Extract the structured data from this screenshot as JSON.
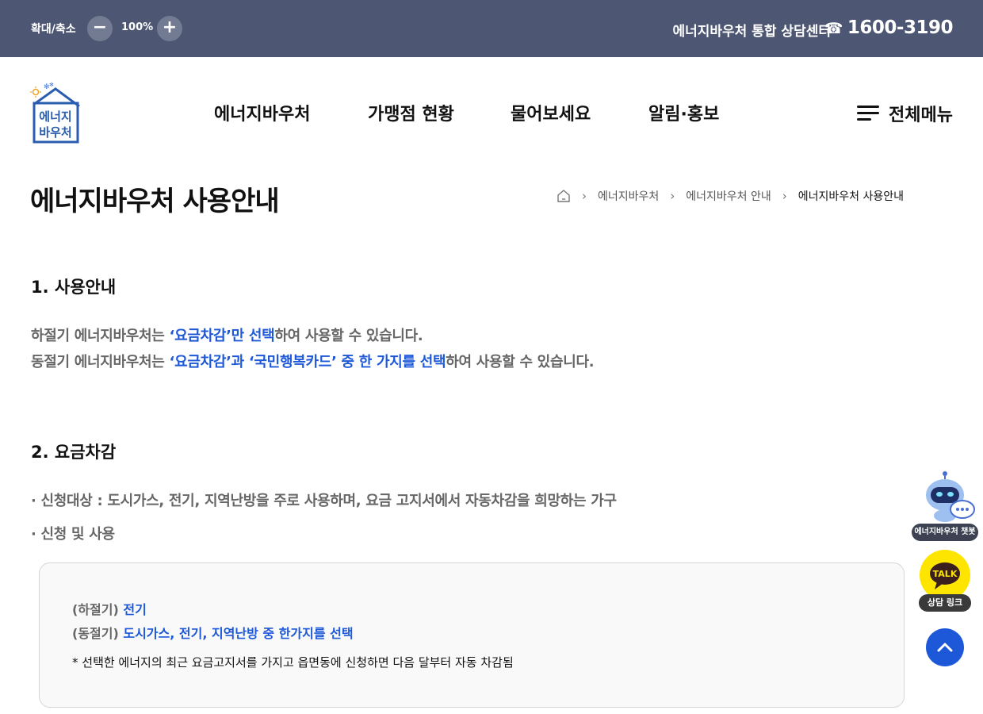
{
  "topbar": {
    "zoom_label": "확대/축소",
    "zoom_minus": "−",
    "zoom_value": "100%",
    "zoom_plus": "+",
    "center_label": "에너지바우처 통합 상담센터",
    "phone_icon": "☎",
    "phone_number": "1600-3190"
  },
  "logo": {
    "line1": "에너지",
    "line2": "바우처"
  },
  "nav": {
    "items": [
      {
        "label": "에너지바우처"
      },
      {
        "label": "가맹점 현황"
      },
      {
        "label": "물어보세요"
      },
      {
        "label": "알림·홍보"
      }
    ],
    "all_menu": "전체메뉴"
  },
  "page": {
    "title": "에너지바우처 사용안내",
    "breadcrumb": [
      "에너지바우처",
      "에너지바우처 안내",
      "에너지바우처 사용안내"
    ]
  },
  "section1": {
    "title": "1. 사용안내",
    "line1": {
      "a": "하절기 에너지바우처는 ",
      "b": "‘요금차감’만 선택",
      "c": "하여 사용할 수 있습니다."
    },
    "line2": {
      "a": "동절기 에너지바우처는 ",
      "b": "‘요금차감’과 ‘국민행복카드’ 중 한 가지를 선택",
      "c": "하여 사용할 수 있습니다."
    }
  },
  "section2": {
    "title": "2. 요금차감",
    "target": "· 신청대상 : 도시가스, 전기, 지역난방을 주로 사용하며, 요금 고지서에서 자동차감을 희망하는 가구",
    "apply": "· 신청 및 사용",
    "box": {
      "summer_label": "(하절기) ",
      "summer_value": "전기",
      "winter_label": "(동절기) ",
      "winter_value": "도시가스, 전기, 지역난방 중 한가지를 선택",
      "note": "* 선택한 에너지의 최근 요금고지서를 가지고 읍면동에 신청하면 다음 달부터 자동 차감됨"
    }
  },
  "widgets": {
    "chatbot_label": "에너지바우처 챗봇",
    "talk_text": "TALK",
    "talk_label": "상담 링크"
  },
  "colors": {
    "topbar": "#4d5672",
    "accent": "#1d58d8",
    "kakao": "#fee500"
  }
}
